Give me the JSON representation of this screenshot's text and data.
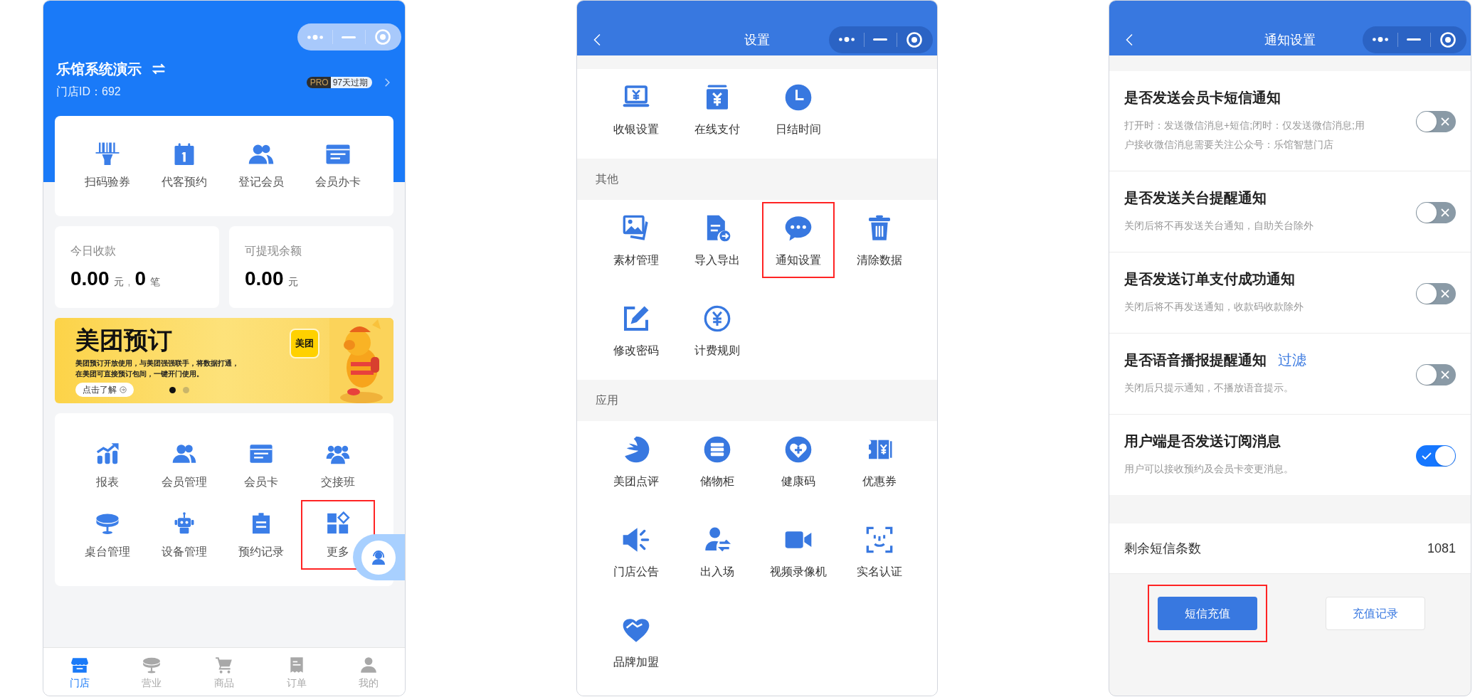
{
  "store_home": {
    "store_name": "乐馆系统演示",
    "store_id": "门店ID：692",
    "plan_badge": "PRO",
    "expiry_badge": "97天过期",
    "quick_actions": [
      {
        "label": "扫码验券"
      },
      {
        "label": "代客预约"
      },
      {
        "label": "登记会员"
      },
      {
        "label": "会员办卡"
      }
    ],
    "stats": [
      {
        "label": "今日收款",
        "amount": "0.00",
        "unit": "元",
        "separator": ",",
        "count": "0",
        "count_unit": "笔"
      },
      {
        "label": "可提现余额",
        "amount": "0.00",
        "unit": "元"
      }
    ],
    "banner": {
      "title": "美团预订",
      "lines": [
        "美团预订开放使用，与美团强强联手，将数据打通，",
        "在美团可直接预订包间，一键开门使用。"
      ],
      "button": "点击了解",
      "logo": "美团",
      "dots": [
        {
          "selected": true
        },
        {
          "selected": false
        }
      ]
    },
    "features": [
      {
        "label": "报表",
        "highlighted": false
      },
      {
        "label": "会员管理",
        "highlighted": false
      },
      {
        "label": "会员卡",
        "highlighted": false
      },
      {
        "label": "交接班",
        "highlighted": false
      },
      {
        "label": "桌台管理",
        "highlighted": false
      },
      {
        "label": "设备管理",
        "highlighted": false
      },
      {
        "label": "预约记录",
        "highlighted": false
      },
      {
        "label": "更多",
        "highlighted": true
      }
    ],
    "tabs": [
      {
        "label": "门店",
        "selected": true
      },
      {
        "label": "营业",
        "selected": false
      },
      {
        "label": "商品",
        "selected": false
      },
      {
        "label": "订单",
        "selected": false
      },
      {
        "label": "我的",
        "selected": false
      }
    ]
  },
  "settings": {
    "title": "设置",
    "sections": [
      {
        "items": [
          {
            "label": "收银设置",
            "highlighted": false
          },
          {
            "label": "在线支付",
            "highlighted": false
          },
          {
            "label": "日结时间",
            "highlighted": false
          }
        ]
      },
      {
        "heading": "其他",
        "items": [
          {
            "label": "素材管理",
            "highlighted": false
          },
          {
            "label": "导入导出",
            "highlighted": false
          },
          {
            "label": "通知设置",
            "highlighted": true
          },
          {
            "label": "清除数据",
            "highlighted": false
          },
          {
            "label": "修改密码",
            "highlighted": false
          },
          {
            "label": "计费规则",
            "highlighted": false
          }
        ]
      },
      {
        "heading": "应用",
        "items": [
          {
            "label": "美团点评",
            "highlighted": false
          },
          {
            "label": "储物柜",
            "highlighted": false
          },
          {
            "label": "健康码",
            "highlighted": false
          },
          {
            "label": "优惠券",
            "highlighted": false
          },
          {
            "label": "门店公告",
            "highlighted": false
          },
          {
            "label": "出入场",
            "highlighted": false
          },
          {
            "label": "视频录像机",
            "highlighted": false
          },
          {
            "label": "实名认证",
            "highlighted": false
          },
          {
            "label": "品牌加盟",
            "highlighted": false
          }
        ]
      }
    ]
  },
  "notification_settings": {
    "title": "通知设置",
    "options": [
      {
        "title": "是否发送会员卡短信通知",
        "description": "打开时：发送微信消息+短信;闭时：仅发送微信消息;用户接收微信消息需要关注公众号：乐馆智慧门店",
        "on": false
      },
      {
        "title": "是否发送关台提醒通知",
        "description": "关闭后将不再发送关台通知，自助关台除外",
        "on": false
      },
      {
        "title": "是否发送订单支付成功通知",
        "description": "关闭后将不再发送通知，收款码收款除外",
        "on": false
      },
      {
        "title": "是否语音播报提醒通知",
        "link": "过滤",
        "description": "关闭后只提示通知，不播放语音提示。",
        "on": false
      },
      {
        "title": "用户端是否发送订阅消息",
        "description": "用户可以接收预约及会员卡变更消息。",
        "on": true
      }
    ],
    "sms_remaining": {
      "label": "剩余短信条数",
      "value": "1081"
    },
    "buttons": [
      {
        "label": "短信充值",
        "kind": "primary",
        "highlighted": true
      },
      {
        "label": "充值记录",
        "kind": "secondary",
        "highlighted": false
      }
    ]
  }
}
